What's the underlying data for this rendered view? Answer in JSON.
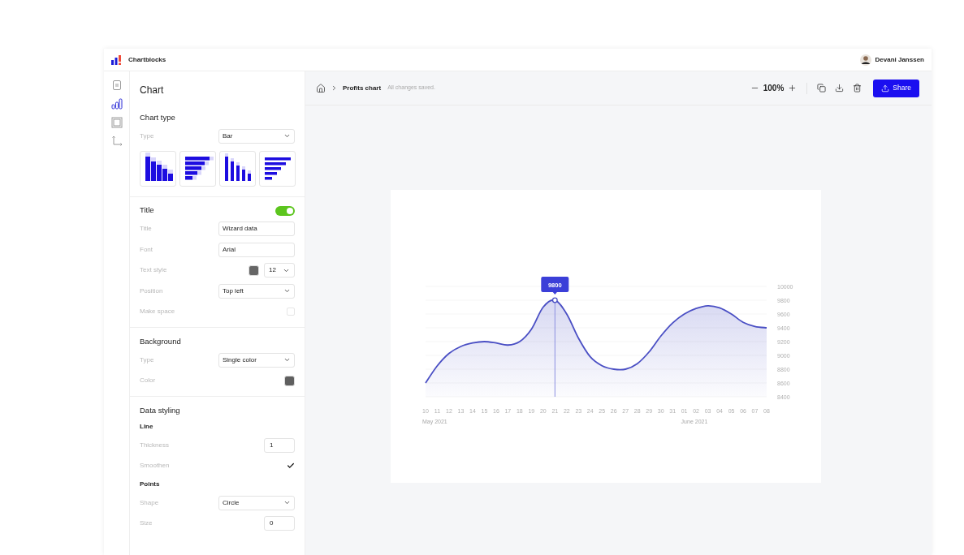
{
  "app": {
    "name": "Chartblocks",
    "user": "Devani Janssen"
  },
  "rail": [
    {
      "kind": "page",
      "selected": false
    },
    {
      "kind": "chart",
      "selected": true
    },
    {
      "kind": "frame",
      "selected": false
    },
    {
      "kind": "axes",
      "selected": false
    }
  ],
  "panel": {
    "title": "Chart",
    "sections": [
      {
        "title": "Chart type",
        "rows": [
          {
            "kind": "select",
            "label": "Type",
            "value": "Bar"
          }
        ],
        "thumbnails": [
          {
            "kind": "vertical"
          },
          {
            "kind": "horizontal"
          },
          {
            "kind": "vertical-thin"
          },
          {
            "kind": "horizontal-thin"
          }
        ]
      },
      {
        "title": "Title",
        "toggle": {
          "on": true
        },
        "rows": [
          {
            "kind": "input",
            "label": "Title",
            "value": "Wizard data"
          },
          {
            "kind": "input",
            "label": "Font",
            "value": "Arial"
          },
          {
            "kind": "textstyle",
            "label": "Text style",
            "color": "#666666",
            "value": "12"
          },
          {
            "kind": "select",
            "label": "Position",
            "value": "Top left"
          },
          {
            "kind": "checkbox",
            "label": "Make space",
            "checked": false
          }
        ]
      },
      {
        "title": "Background",
        "rows": [
          {
            "kind": "select",
            "label": "Type",
            "value": "Single color"
          },
          {
            "kind": "color",
            "label": "Color",
            "color": "#5f5f5f"
          }
        ]
      },
      {
        "title": "Data styling",
        "rows": [
          {
            "kind": "heading",
            "label": "Line"
          },
          {
            "kind": "number",
            "label": "Thickness",
            "value": "1"
          },
          {
            "kind": "checkbox",
            "label": "Smoothen",
            "checked": true
          },
          {
            "kind": "heading",
            "label": "Points"
          },
          {
            "kind": "select",
            "label": "Shape",
            "value": "Circle"
          },
          {
            "kind": "number",
            "label": "Size",
            "value": "0"
          }
        ]
      }
    ]
  },
  "toolbar": {
    "breadcrumb": "Profits chart",
    "status": "All changes saved.",
    "zoom": "100%",
    "share": "Share"
  },
  "chart": {
    "month_labels": [
      "May 2021",
      "June 2021"
    ],
    "chart_data": {
      "type": "area",
      "annotations": [
        {
          "text": "9800",
          "x": "21"
        }
      ],
      "ref_lines": [
        {
          "axis": "x",
          "value": "21",
          "color": "#8b8fe0"
        }
      ],
      "categories": [
        "10",
        "11",
        "12",
        "13",
        "14",
        "15",
        "16",
        "17",
        "18",
        "19",
        "20",
        "21",
        "22",
        "23",
        "24",
        "25",
        "26",
        "27",
        "28",
        "29",
        "30",
        "31",
        "01",
        "02",
        "03",
        "04",
        "05",
        "06",
        "07",
        "08"
      ],
      "series": [
        {
          "color": "#4a4fc4",
          "values": [
            8600,
            8850,
            9030,
            9130,
            9180,
            9200,
            9180,
            9150,
            9200,
            9380,
            9700,
            9800,
            9600,
            9250,
            8980,
            8850,
            8800,
            8800,
            8880,
            9050,
            9280,
            9470,
            9600,
            9680,
            9720,
            9690,
            9600,
            9480,
            9420,
            9400
          ]
        }
      ],
      "ylim": [
        8400,
        10000
      ],
      "yticks": [
        8400,
        8600,
        8800,
        9000,
        9200,
        9400,
        9600,
        9800,
        10000
      ]
    }
  }
}
